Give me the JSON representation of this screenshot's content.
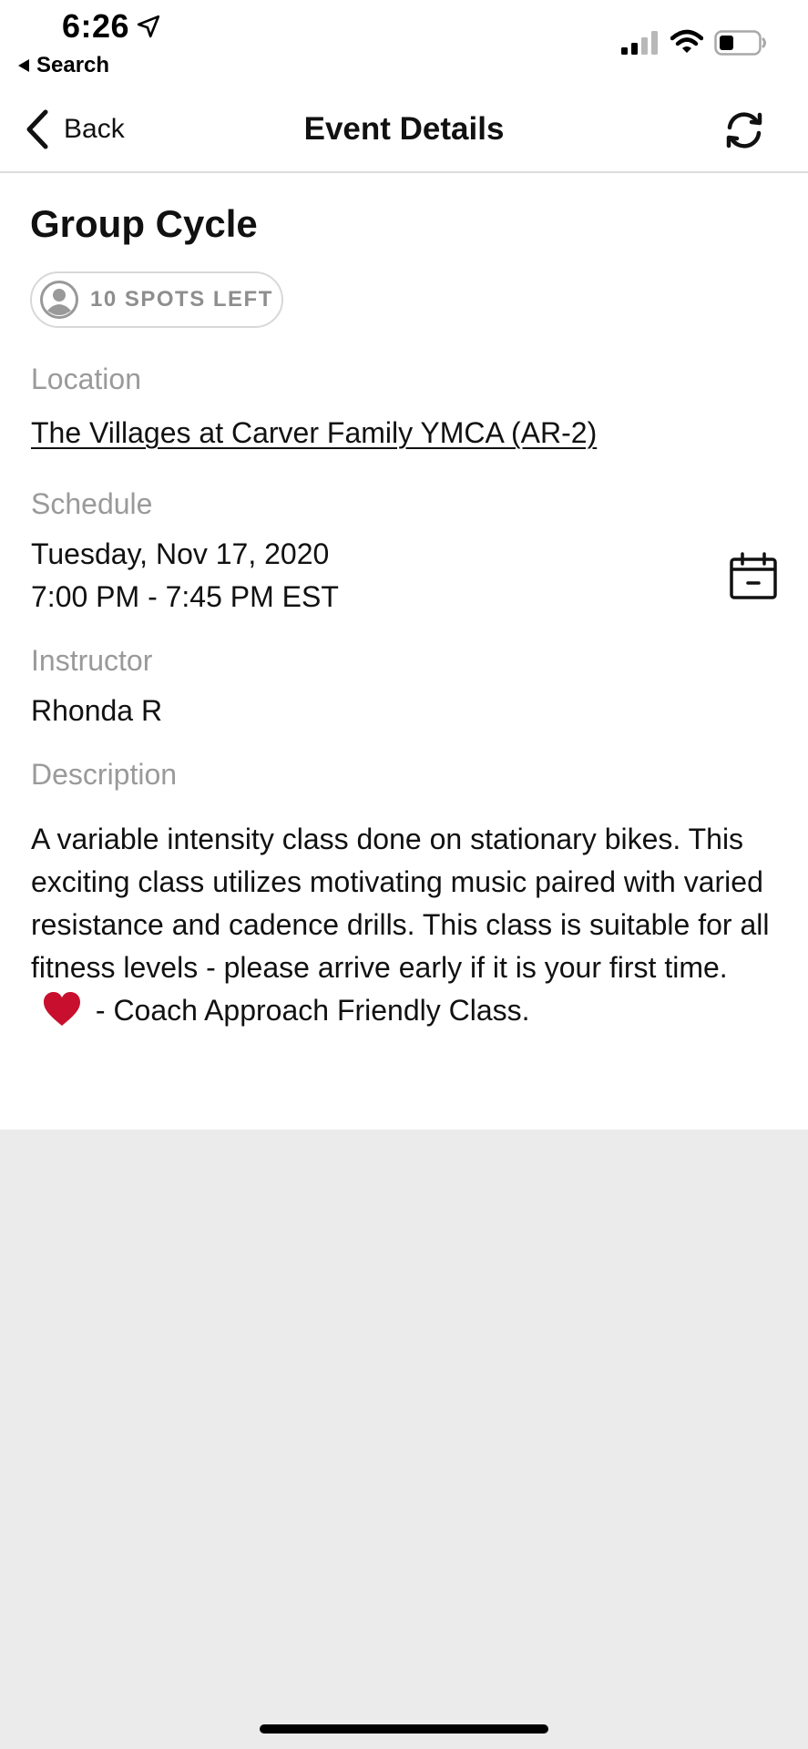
{
  "status_bar": {
    "time": "6:26",
    "back_app_label": "Search"
  },
  "nav": {
    "back_label": "Back",
    "title": "Event Details"
  },
  "event": {
    "title": "Group Cycle",
    "spots_left": "10 SPOTS LEFT",
    "location_label": "Location",
    "location_value": "The Villages at Carver Family YMCA (AR-2)",
    "schedule_label": "Schedule",
    "schedule_date": "Tuesday, Nov 17, 2020",
    "schedule_time": "7:00 PM - 7:45 PM EST",
    "instructor_label": "Instructor",
    "instructor_value": "Rhonda R",
    "description_label": "Description",
    "description_part1": "A variable intensity class done on stationary bikes. This exciting class utilizes motivating music paired with varied resistance and cadence drills. This class is suitable for all fitness levels - please arrive early if it is your first time.",
    "description_part2": " - Coach Approach Friendly Class."
  },
  "icons": {
    "back": "chevron-left-icon",
    "refresh": "refresh-icon",
    "calendar": "calendar-icon",
    "person": "person-icon",
    "heart": "heart-icon"
  },
  "colors": {
    "label_gray": "#9a9a9a",
    "badge_gray": "#8e8e8e",
    "background_gray": "#ebebeb",
    "heart_red": "#c8102e"
  }
}
